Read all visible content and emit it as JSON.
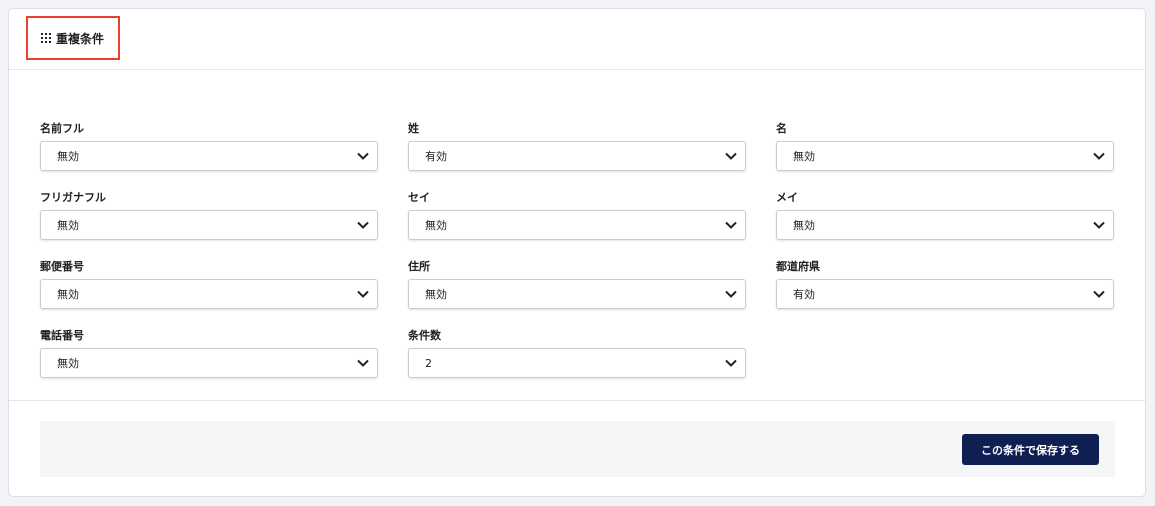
{
  "header": {
    "title": "重複条件",
    "icon": "grid-icon"
  },
  "fields": {
    "name_full": {
      "label": "名前フル",
      "value": "無効"
    },
    "last_name": {
      "label": "姓",
      "value": "有効"
    },
    "first_name": {
      "label": "名",
      "value": "無効"
    },
    "furigana_full": {
      "label": "フリガナフル",
      "value": "無効"
    },
    "sei": {
      "label": "セイ",
      "value": "無効"
    },
    "mei": {
      "label": "メイ",
      "value": "無効"
    },
    "postal_code": {
      "label": "郵便番号",
      "value": "無効"
    },
    "address": {
      "label": "住所",
      "value": "無効"
    },
    "prefecture": {
      "label": "都道府県",
      "value": "有効"
    },
    "phone": {
      "label": "電話番号",
      "value": "無効"
    },
    "condition_count": {
      "label": "条件数",
      "value": "2"
    }
  },
  "footer": {
    "save_label": "この条件で保存する"
  },
  "colors": {
    "accent": "#0f1f52",
    "highlight_border": "#e8402a"
  }
}
